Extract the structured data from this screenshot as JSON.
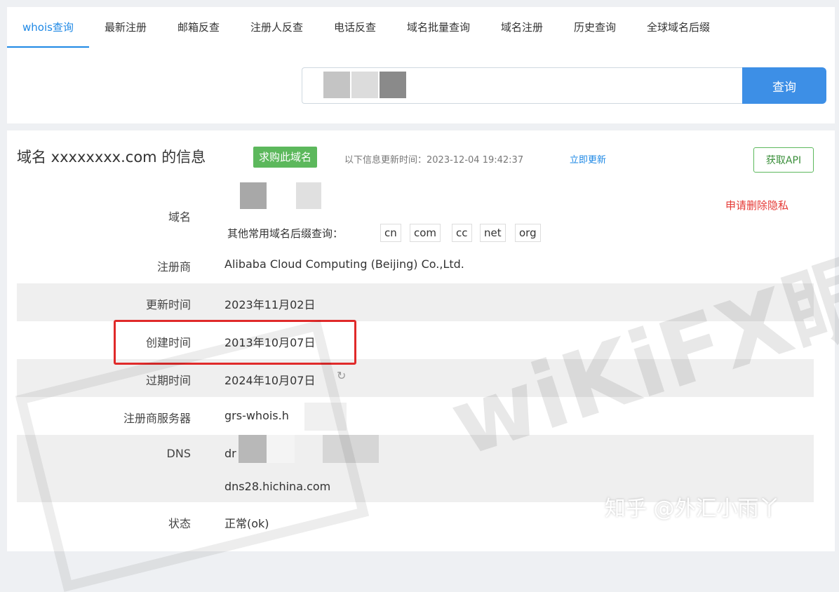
{
  "tabs": [
    {
      "label": "whois查询",
      "active": true
    },
    {
      "label": "最新注册"
    },
    {
      "label": "邮箱反查"
    },
    {
      "label": "注册人反查"
    },
    {
      "label": "电话反查"
    },
    {
      "label": "域名批量查询"
    },
    {
      "label": "域名注册"
    },
    {
      "label": "历史查询"
    },
    {
      "label": "全球域名后缀"
    }
  ],
  "search": {
    "button_label": "查询"
  },
  "info": {
    "title": "域名 xxxxxxxx.com 的信息",
    "buy_label": "求购此域名",
    "update_prefix": "以下信息更新时间：",
    "update_time": "2023-12-04 19:42:37",
    "refresh_label": "立即更新",
    "api_label": "获取API",
    "privacy_label": "申请删除隐私",
    "suffix_label": "其他常用域名后缀查询：",
    "suffixes": [
      "cn",
      "com",
      "cc",
      "net",
      "org"
    ]
  },
  "rows": {
    "domain": {
      "label": "域名"
    },
    "registrar": {
      "label": "注册商",
      "value": "Alibaba Cloud Computing (Beijing) Co.,Ltd."
    },
    "updated": {
      "label": "更新时间",
      "value": "2023年11月02日"
    },
    "created": {
      "label": "创建时间",
      "value": "2013年10月07日"
    },
    "expires": {
      "label": "过期时间",
      "value": "2024年10月07日"
    },
    "server": {
      "label": "注册商服务器",
      "value": "grs-whois.h"
    },
    "dns": {
      "label": "DNS",
      "value1": "dr",
      "value2": "dns28.hichina.com"
    },
    "status": {
      "label": "状态",
      "value": "正常(ok)"
    }
  },
  "watermark": "wiKiFX眼",
  "credit": "知乎 @外汇小雨丫",
  "colors": {
    "accent": "#1e88e5",
    "buy": "#5cb85c",
    "privacy": "#e53935",
    "highlight": "#e02a2a"
  }
}
